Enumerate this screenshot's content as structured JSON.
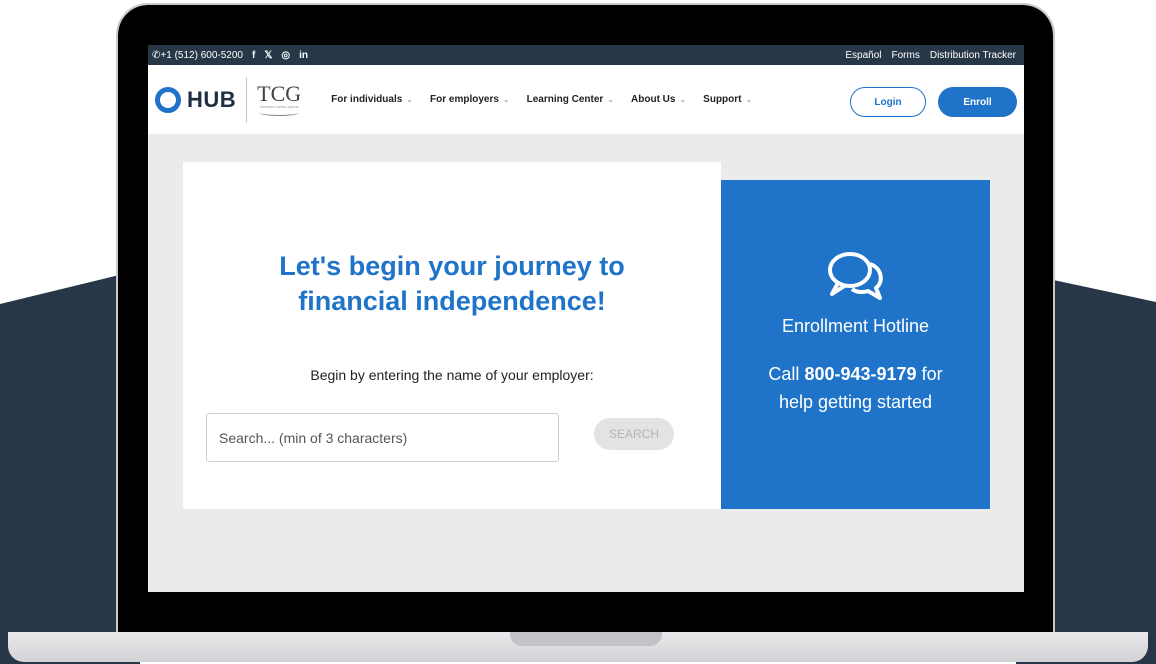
{
  "topbar": {
    "phone": "+1 (512) 600-5200",
    "social": [
      "f",
      "𝕏",
      "◎",
      "in"
    ],
    "links": [
      "Español",
      "Forms",
      "Distribution Tracker"
    ]
  },
  "header": {
    "logo_hub": "HUB",
    "logo_tcg": "TCG",
    "logo_tcg_sub": "TRUSTED CAPITAL GROUP",
    "nav": [
      {
        "label": "For individuals"
      },
      {
        "label": "For employers"
      },
      {
        "label": "Learning Center"
      },
      {
        "label": "About Us"
      },
      {
        "label": "Support"
      }
    ],
    "login_label": "Login",
    "enroll_label": "Enroll"
  },
  "main": {
    "headline_line1": "Let's begin your journey to",
    "headline_line2": "financial independence!",
    "prompt": "Begin by entering the name of your employer:",
    "search_placeholder": "Search... (min of 3 characters)",
    "search_button": "SEARCH"
  },
  "hotline": {
    "title": "Enrollment Hotline",
    "call_prefix": "Call",
    "number": "800-943-9179",
    "call_suffix": "for",
    "line2": "help getting started"
  },
  "colors": {
    "brand_blue": "#1f73c8",
    "topbar": "#273747",
    "page_bg": "#ebebeb"
  }
}
